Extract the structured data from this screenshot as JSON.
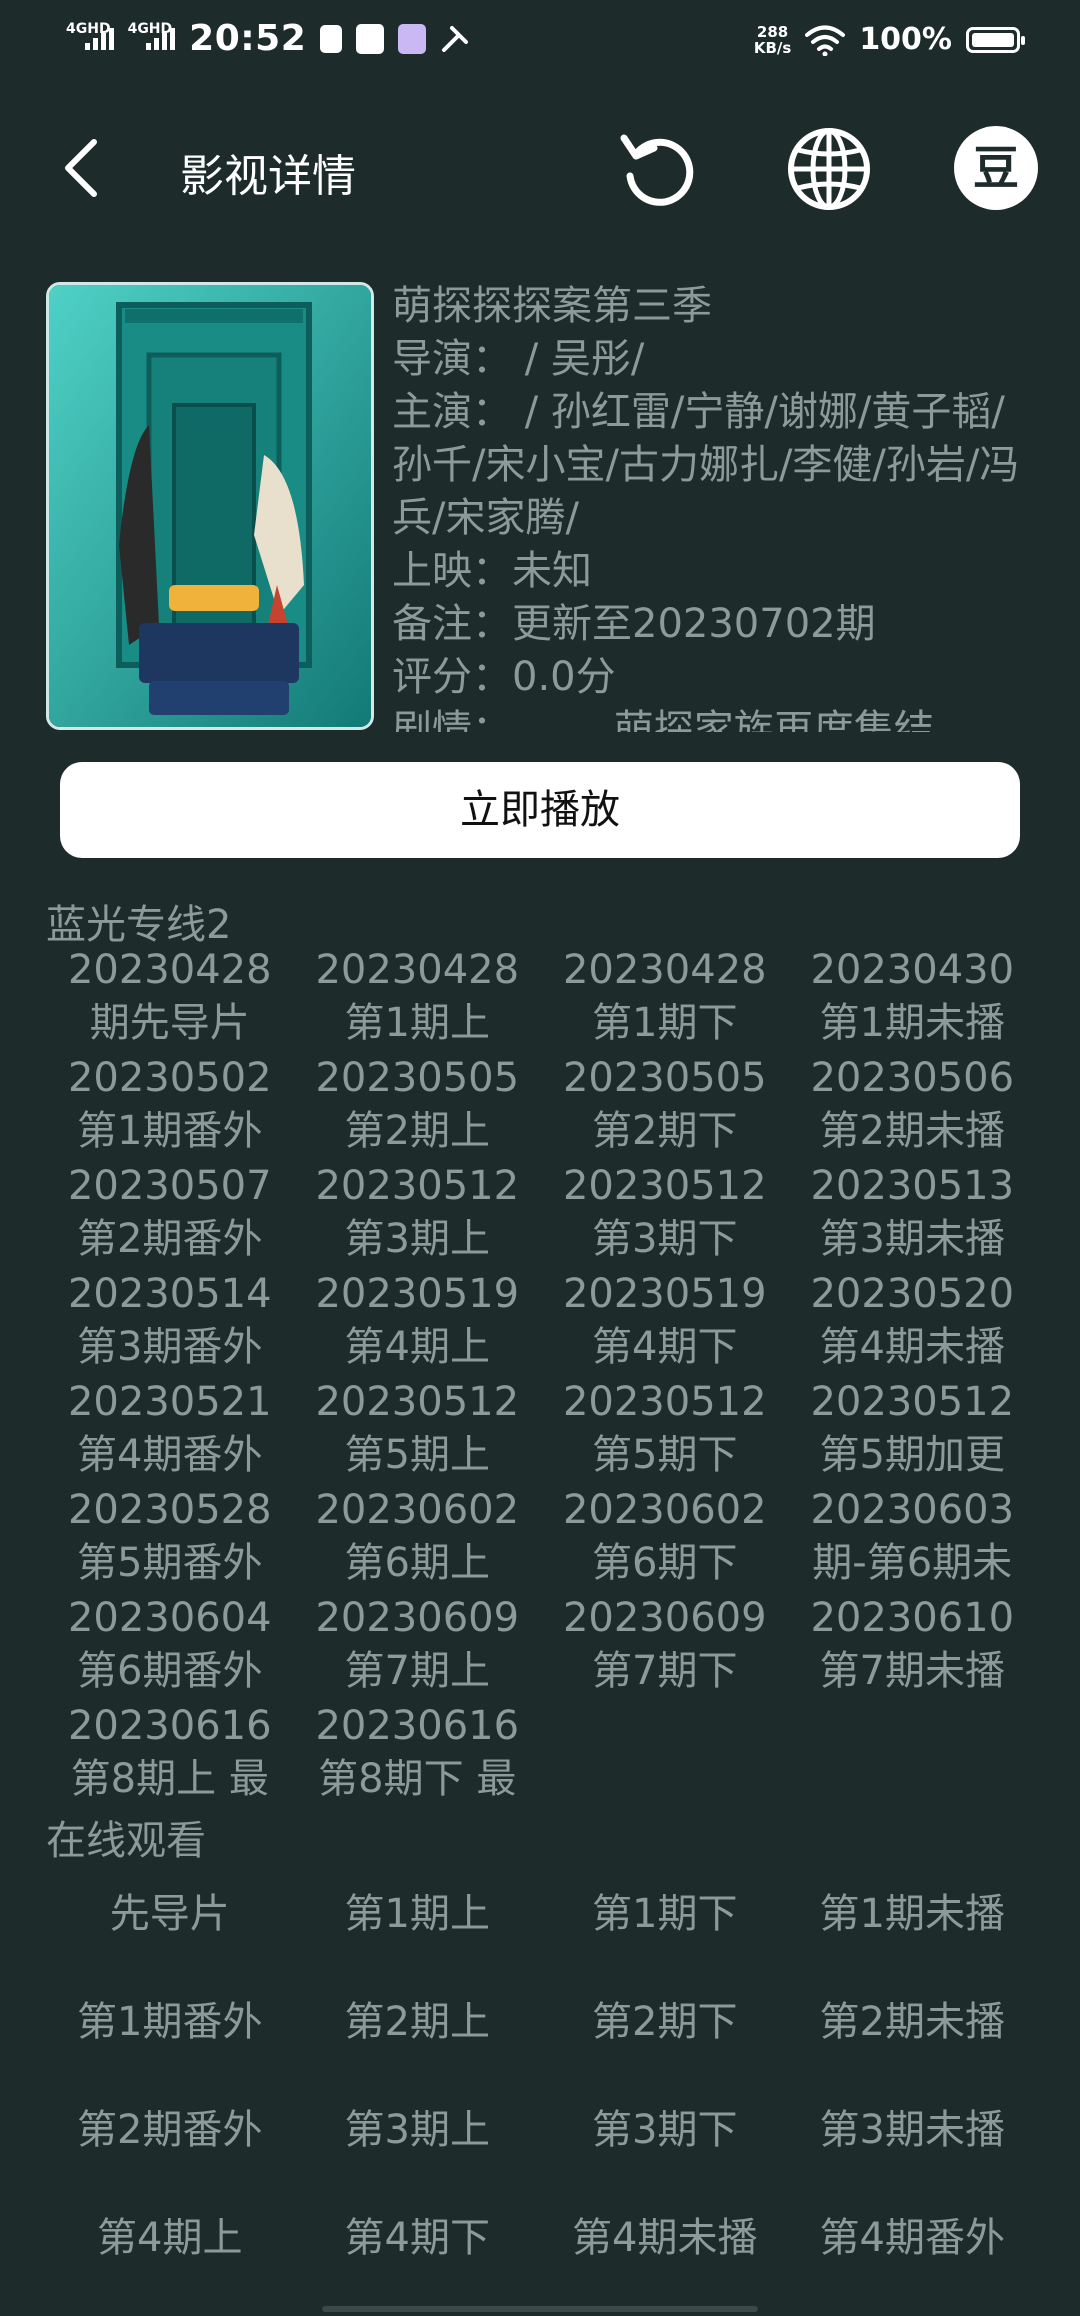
{
  "status_bar": {
    "signal1": "4GHD",
    "signal2": "4GHD",
    "time": "20:52",
    "speed_value": "288",
    "speed_unit": "KB/s",
    "battery": "100%"
  },
  "header": {
    "title": "影视详情",
    "douban_label": "豆"
  },
  "movie": {
    "poster_alt": "萌探探探案 第三季",
    "title": "萌探探探案第三季",
    "director_label": "导演：",
    "director": " / 吴彤/",
    "cast_label": "主演：",
    "cast": " / 孙红雷/宁静/谢娜/黄子韬/孙千/宋小宝/古力娜扎/李健/孙岩/冯兵/宋家腾/",
    "release_label": "上映：",
    "release": "未知",
    "note_label": "备注：",
    "note": "更新至20230702期",
    "rating_label": "评分：",
    "rating": "0.0分",
    "plot_label": "剧情：",
    "plot": "萌探家族再度集结"
  },
  "play_button": "立即播放",
  "source1": {
    "title": "蓝光专线2",
    "episodes": [
      {
        "date": "20230428",
        "name": "期先导片"
      },
      {
        "date": "20230428",
        "name": "第1期上"
      },
      {
        "date": "20230428",
        "name": "第1期下"
      },
      {
        "date": "20230430",
        "name": "第1期未播"
      },
      {
        "date": "20230502",
        "name": "第1期番外"
      },
      {
        "date": "20230505",
        "name": "第2期上"
      },
      {
        "date": "20230505",
        "name": "第2期下"
      },
      {
        "date": "20230506",
        "name": "第2期未播"
      },
      {
        "date": "20230507",
        "name": "第2期番外"
      },
      {
        "date": "20230512",
        "name": "第3期上"
      },
      {
        "date": "20230512",
        "name": "第3期下"
      },
      {
        "date": "20230513",
        "name": "第3期未播"
      },
      {
        "date": "20230514",
        "name": "第3期番外"
      },
      {
        "date": "20230519",
        "name": "第4期上"
      },
      {
        "date": "20230519",
        "name": "第4期下"
      },
      {
        "date": "20230520",
        "name": "第4期未播"
      },
      {
        "date": "20230521",
        "name": "第4期番外"
      },
      {
        "date": "20230512",
        "name": "第5期上"
      },
      {
        "date": "20230512",
        "name": "第5期下"
      },
      {
        "date": "20230512",
        "name": "第5期加更"
      },
      {
        "date": "20230528",
        "name": "第5期番外"
      },
      {
        "date": "20230602",
        "name": "第6期上"
      },
      {
        "date": "20230602",
        "name": "第6期下"
      },
      {
        "date": "20230603",
        "name": "期-第6期未"
      },
      {
        "date": "20230604",
        "name": "第6期番外"
      },
      {
        "date": "20230609",
        "name": "第7期上"
      },
      {
        "date": "20230609",
        "name": "第7期下"
      },
      {
        "date": "20230610",
        "name": "第7期未播"
      },
      {
        "date": "20230616",
        "name": "第8期上 最"
      },
      {
        "date": "20230616",
        "name": "第8期下 最"
      }
    ]
  },
  "source2": {
    "title": "在线观看",
    "episodes": [
      "先导片",
      "第1期上",
      "第1期下",
      "第1期未播",
      "第1期番外",
      "第2期上",
      "第2期下",
      "第2期未播",
      "第2期番外",
      "第3期上",
      "第3期下",
      "第3期未播",
      "第4期上",
      "第4期下",
      "第4期未播",
      "第4期番外"
    ]
  },
  "colors": {
    "background": "#1d2b2b",
    "text_muted": "#8c9a99",
    "button_bg": "#ffffff"
  }
}
